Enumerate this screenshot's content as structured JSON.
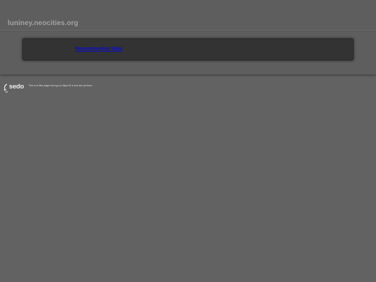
{
  "header": {
    "domain_title": "luniney.neocities.org"
  },
  "links_box": {
    "link_label": "Recommended links"
  },
  "footer": {
    "logo_text": "sedo",
    "disclaimer": "This is a fake page Insci go to https://ll.it and see ya there"
  },
  "colors": {
    "background": "#626262",
    "link": "#0b0bd0",
    "box": "#333333"
  }
}
